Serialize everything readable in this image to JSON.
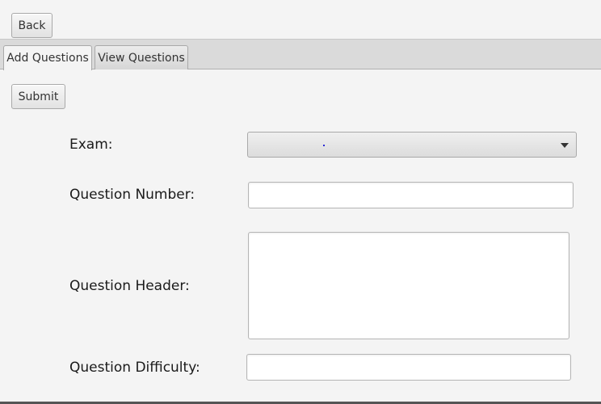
{
  "toolbar": {
    "back_label": "Back"
  },
  "tabs": [
    {
      "label": "Add Questions",
      "selected": true
    },
    {
      "label": "View Questions",
      "selected": false
    }
  ],
  "form": {
    "submit_label": "Submit",
    "exam_label": "Exam:",
    "exam_value": "",
    "question_number_label": "Question Number:",
    "question_number_value": "",
    "question_header_label": "Question Header:",
    "question_header_value": "",
    "question_difficulty_label": "Question Difficulty:",
    "question_difficulty_value": ""
  }
}
